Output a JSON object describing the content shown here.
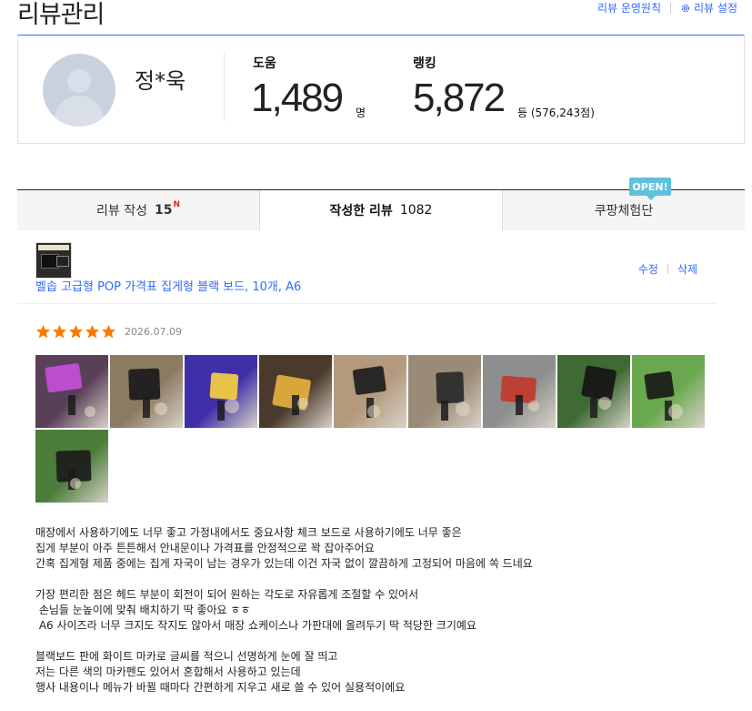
{
  "header": {
    "title": "리뷰관리",
    "links": {
      "policy": "리뷰 운영원칙",
      "settings": "리뷰 설정"
    }
  },
  "profile": {
    "name": "정*욱",
    "help": {
      "label": "도움",
      "value": "1,489",
      "unit": "명"
    },
    "ranking": {
      "label": "랭킹",
      "value": "5,872",
      "unit": "등 (576,243점)"
    }
  },
  "tabs": [
    {
      "label": "리뷰 작성",
      "count": "15",
      "badge": "N"
    },
    {
      "label": "작성한 리뷰",
      "count": "1082"
    },
    {
      "label": "쿠팡체험단",
      "badge": "OPEN!"
    }
  ],
  "review": {
    "product_name": "벨솝 고급형 POP 가격표 집게형 블랙 보드, 10개, A6",
    "edit": "수정",
    "delete": "삭제",
    "rating": 5,
    "date": "2026.07.09",
    "star_color": "#f77c00",
    "photos": [
      {
        "icon": "photo-neon-board-purple",
        "bg": "#5a3f58",
        "accent": "#c24fd6"
      },
      {
        "icon": "photo-board-hand-chalk",
        "bg": "#8d7a62",
        "accent": "#1a1a1a"
      },
      {
        "icon": "photo-board-neon-blue",
        "bg": "#3f2fa8",
        "accent": "#f5d041"
      },
      {
        "icon": "photo-board-markers",
        "bg": "#4a3a2c",
        "accent": "#e3b13d"
      },
      {
        "icon": "photo-board-text-clip",
        "bg": "#b39a7c",
        "accent": "#1e1e1e"
      },
      {
        "icon": "photo-clip-hand-cloth",
        "bg": "#9a8a78",
        "accent": "#2a2a2a"
      },
      {
        "icon": "photo-clips-bundle",
        "bg": "#8e8e8e",
        "accent": "#c0392b"
      },
      {
        "icon": "photo-board-black-hand",
        "bg": "#3d6b33",
        "accent": "#151515"
      },
      {
        "icon": "photo-board-side-grass",
        "bg": "#6aa84f",
        "accent": "#1a1a1a"
      },
      {
        "icon": "photo-boards-parts-grass",
        "bg": "#4c7d3a",
        "accent": "#1c1c1c"
      }
    ],
    "paragraphs": [
      [
        "매장에서 사용하기에도 너무 좋고 가정내에서도 중요사항 체크 보드로 사용하기에도 너무 좋은",
        "집게 부분이 아주 튼튼해서 안내문이나 가격표를 안정적으로 꽉 잡아주어요",
        "간혹 집게형 제품 중에는 집게 자국이 남는 경우가 있는데 이건 자국 없이 깔끔하게 고정되어 마음에 쏙 드네요"
      ],
      [
        "가장 편리한 점은 헤드 부분이 회전이 되어 원하는 각도로 자유롭게 조절할 수 있어서",
        " 손님들 눈높이에 맞춰 배치하기 딱 좋아요 ㅎㅎ",
        " A6 사이즈라 너무 크지도 작지도 않아서 매장 쇼케이스나 가판대에 올려두기 딱 적당한 크기예요"
      ],
      [
        "블랙보드 판에 화이트 마카로 글씨를 적으니 선명하게 눈에 잘 띄고",
        "저는 다른 색의 마카펜도 있어서 혼합해서 사용하고 있는데",
        "행사 내용이나 메뉴가 바뀔 때마다 간편하게 지우고 새로 쓸 수 있어 실용적이에요"
      ]
    ]
  }
}
